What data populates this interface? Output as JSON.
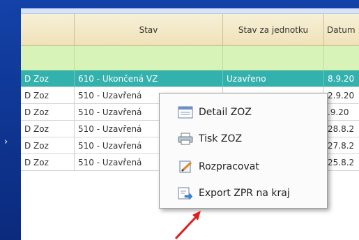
{
  "columns": [
    "",
    "Stav",
    "Stav za jednotku",
    "Datum"
  ],
  "rows": [
    {
      "type": "D Zoz",
      "stav": "610 - Ukončená VZ",
      "stav_jednotka": "Uzavřeno",
      "datum": "8.9.20"
    },
    {
      "type": "D Zoz",
      "stav": "510 - Uzavřená",
      "stav_jednotka": "",
      "datum": "2.9.20"
    },
    {
      "type": "D Zoz",
      "stav": "510 - Uzavřená",
      "stav_jednotka": "",
      "datum": ".9.20"
    },
    {
      "type": "D Zoz",
      "stav": "510 - Uzavřená",
      "stav_jednotka": "",
      "datum": "28.8.2"
    },
    {
      "type": "D Zoz",
      "stav": "510 - Uzavřená",
      "stav_jednotka": "",
      "datum": "27.8.2"
    },
    {
      "type": "D Zoz",
      "stav": "510 - Uzavřená",
      "stav_jednotka": "",
      "datum": "25.8.2"
    }
  ],
  "context_menu": [
    {
      "label": "Detail ZOZ",
      "icon": "detail-icon"
    },
    {
      "label": "Tisk ZOZ",
      "icon": "printer-icon"
    },
    {
      "label": "Rozpracovat",
      "icon": "edit-document-icon"
    },
    {
      "label": "Export ZPR na kraj",
      "icon": "export-icon"
    }
  ],
  "colors": {
    "selected_row": "#33b1ad",
    "header_bg": "#efe2b8",
    "filter_row": "#d8f3b8",
    "frame": "#0d2f8a",
    "arrow": "#e02020"
  }
}
